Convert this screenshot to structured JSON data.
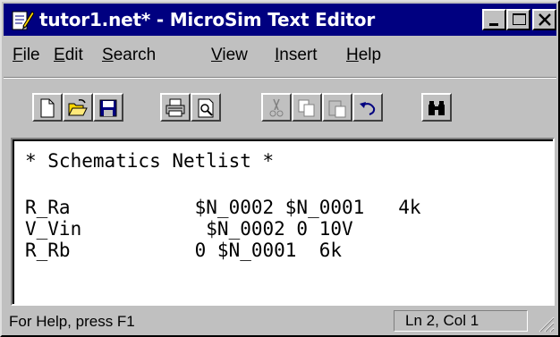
{
  "window": {
    "title": "tutor1.net* - MicroSim Text Editor",
    "title_bar_color": "#000080"
  },
  "menu": {
    "items": [
      {
        "underline": "F",
        "rest": "ile"
      },
      {
        "underline": "E",
        "rest": "dit"
      },
      {
        "underline": "S",
        "rest": "earch"
      },
      {
        "underline": "V",
        "rest": "iew"
      },
      {
        "underline": "I",
        "rest": "nsert"
      },
      {
        "underline": "H",
        "rest": "elp"
      }
    ]
  },
  "toolbar": {
    "buttons": [
      "new-file-icon",
      "open-folder-icon",
      "save-disk-icon",
      "print-icon",
      "print-preview-icon",
      "cut-icon",
      "copy-icon",
      "paste-icon",
      "undo-icon",
      "find-binoculars-icon"
    ]
  },
  "editor": {
    "lines": [
      "* Schematics Netlist *",
      "",
      "R_Ra           $N_0002 $N_0001   4k",
      "V_Vin           $N_0002 0 10V",
      "R_Rb           0 $N_0001  6k"
    ]
  },
  "status": {
    "help_text": "For Help, press F1",
    "position": "Ln 2, Col 1"
  }
}
